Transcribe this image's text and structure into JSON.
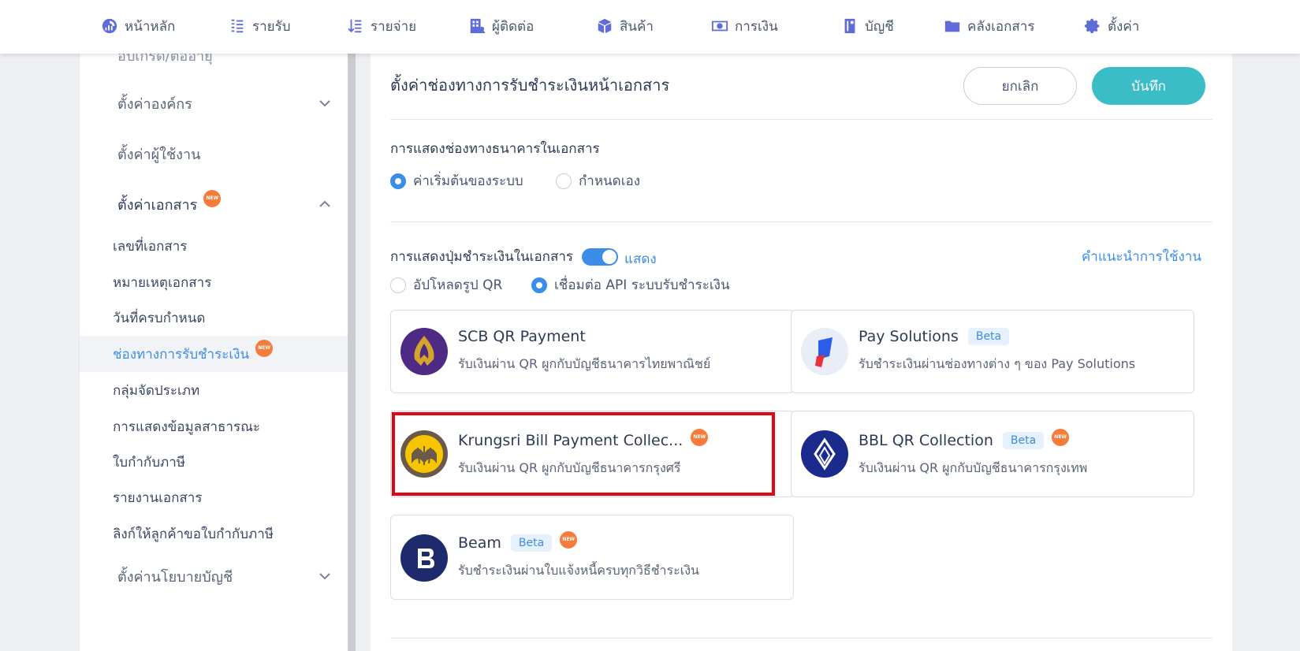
{
  "nav": {
    "items": [
      {
        "label": "หน้าหลัก",
        "icon": "dashboard-icon"
      },
      {
        "label": "รายรับ",
        "icon": "income-icon"
      },
      {
        "label": "รายจ่าย",
        "icon": "expense-icon"
      },
      {
        "label": "ผู้ติดต่อ",
        "icon": "contacts-icon"
      },
      {
        "label": "สินค้า",
        "icon": "box-icon"
      },
      {
        "label": "การเงิน",
        "icon": "money-icon"
      },
      {
        "label": "บัญชี",
        "icon": "ledger-icon"
      },
      {
        "label": "คลังเอกสาร",
        "icon": "folder-icon"
      },
      {
        "label": "ตั้งค่า",
        "icon": "gear-icon"
      }
    ]
  },
  "sidebar": {
    "top_partial": "อัปเกรด/ต่ออายุ",
    "groups": {
      "org": "ตั้งค่าองค์กร",
      "user": "ตั้งค่าผู้ใช้งาน",
      "doc": "ตั้งค่าเอกสาร",
      "policy": "ตั้งค่านโยบายบัญชี"
    },
    "new_badge": "NEW",
    "items": [
      "เลขที่เอกสาร",
      "หมายเหตุเอกสาร",
      "วันที่ครบกำหนด",
      "ช่องทางการรับชำระเงิน",
      "กลุ่มจัดประเภท",
      "การแสดงข้อมูลสาธารณะ",
      "ใบกำกับภาษี",
      "รายงานเอกสาร",
      "ลิงก์ให้ลูกค้าขอใบกำกับภาษี"
    ]
  },
  "page": {
    "title": "ตั้งค่าช่องทางการรับชำระเงินหน้าเอกสาร",
    "cancel": "ยกเลิก",
    "save": "บันทึก",
    "bank_section": {
      "label": "การแสดงช่องทางธนาคารในเอกสาร",
      "opt_default": "ค่าเริ่มต้นของระบบ",
      "opt_custom": "กำหนดเอง",
      "selected": "default"
    },
    "pay_section": {
      "label": "การแสดงปุ่มชำระเงินในเอกสาร",
      "toggle_label": "แสดง",
      "toggle_on": true,
      "help": "คำแนะนำการใช้งาน",
      "opt_upload": "อัปโหลดรูป QR",
      "opt_api": "เชื่อมต่อ API ระบบรับชำระเงิน",
      "selected": "api"
    },
    "beta_label": "Beta",
    "cards": [
      {
        "title": "SCB QR Payment",
        "desc": "รับเงินผ่าน QR ผูกกับบัญชีธนาคารไทยพาณิชย์"
      },
      {
        "title": "Pay Solutions",
        "desc": "รับชำระเงินผ่านช่องทางต่าง ๆ ของ Pay Solutions"
      },
      {
        "title": "Krungsri Bill Payment Collec...",
        "desc": "รับเงินผ่าน QR ผูกกับบัญชีธนาคารกรุงศรี"
      },
      {
        "title": "BBL QR Collection",
        "desc": "รับเงินผ่าน QR ผูกกับบัญชีธนาคารกรุงเทพ"
      },
      {
        "title": "Beam",
        "desc": "รับชำระเงินผ่านใบแจ้งหนี้ครบทุกวิธีชำระเงิน"
      }
    ]
  },
  "colors": {
    "accent": "#3b8de8",
    "save_button": "#3bbdc8",
    "highlight": "#e30613",
    "new_badge": "#f57c3b"
  }
}
